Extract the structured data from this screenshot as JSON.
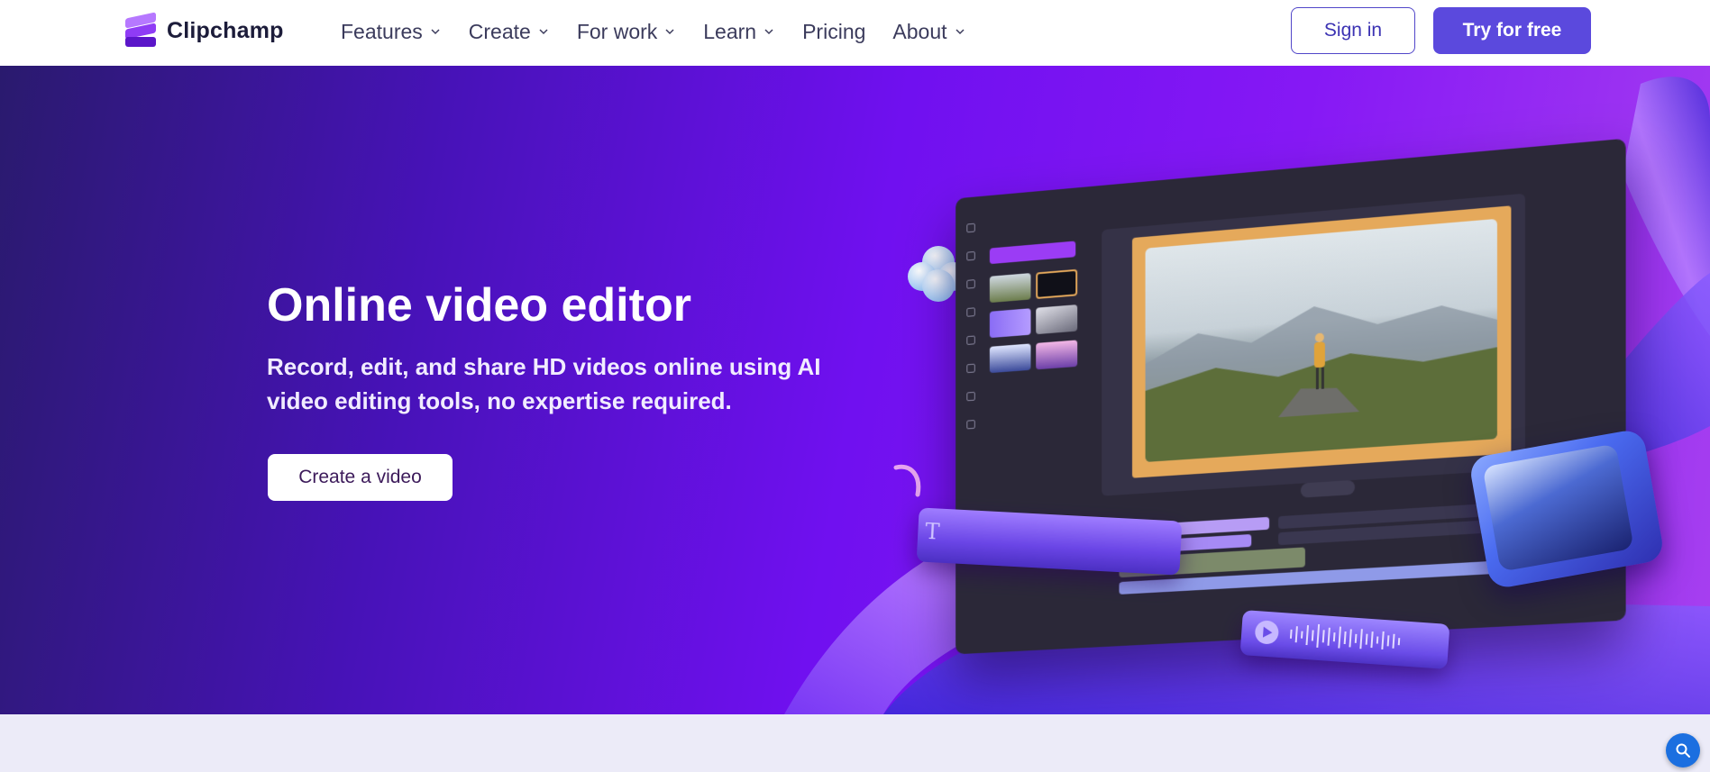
{
  "brand": {
    "name": "Clipchamp"
  },
  "nav": {
    "items": [
      {
        "label": "Features",
        "has_dropdown": true
      },
      {
        "label": "Create",
        "has_dropdown": true
      },
      {
        "label": "For work",
        "has_dropdown": true
      },
      {
        "label": "Learn",
        "has_dropdown": true
      },
      {
        "label": "Pricing",
        "has_dropdown": false
      },
      {
        "label": "About",
        "has_dropdown": true
      }
    ],
    "signin_label": "Sign in",
    "try_label": "Try for free"
  },
  "hero": {
    "title": "Online video editor",
    "subtitle": "Record, edit, and share HD videos online using AI video editing tools, no expertise required.",
    "cta_label": "Create a video"
  },
  "colors": {
    "accent": "#5b49dd",
    "hero_start": "#2a1a6e",
    "hero_mid": "#7010f0",
    "hero_end": "#a740f0",
    "bottom_bg": "#ecebf8"
  },
  "icons": {
    "logo": "clipchamp-logo-icon",
    "chevron": "chevron-down-icon",
    "fab": "search-icon"
  }
}
